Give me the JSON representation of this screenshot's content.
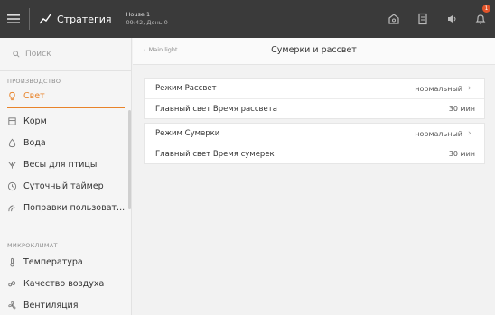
{
  "header": {
    "strategy_label": "Стратегия",
    "house_name": "House 1",
    "house_time": "09:42, День 0",
    "notification_count": "1"
  },
  "sidebar": {
    "search_placeholder": "Поиск",
    "section_production": "ПРОИЗВОДСТВО",
    "section_microclimate": "МИКРОКЛИМАТ",
    "items": [
      {
        "label": "Свет",
        "icon": "lightbulb-icon",
        "active": true
      },
      {
        "label": "Корм",
        "icon": "feed-icon"
      },
      {
        "label": "Вода",
        "icon": "water-drop-icon"
      },
      {
        "label": "Весы для птицы",
        "icon": "bird-scale-icon"
      },
      {
        "label": "Суточный таймер",
        "icon": "clock-icon"
      },
      {
        "label": "Поправки пользоват...",
        "icon": "user-adjust-icon"
      },
      {
        "label": "Температура",
        "icon": "thermometer-icon"
      },
      {
        "label": "Качество воздуха",
        "icon": "air-quality-icon"
      },
      {
        "label": "Вентиляция",
        "icon": "ventilation-icon"
      }
    ]
  },
  "main": {
    "back_label": "Main light",
    "title": "Сумерки и рассвет",
    "rows": [
      {
        "label": "Режим Рассвет",
        "value": "нормальный"
      },
      {
        "label": "Главный свет Время рассвета",
        "value": "30 мин"
      },
      {
        "label": "Режим Сумерки",
        "value": "нормальный"
      },
      {
        "label": "Главный свет Время сумерек",
        "value": "30 мин"
      }
    ]
  },
  "colors": {
    "accent": "#e8832a",
    "topbar": "#3a3a3a",
    "badge": "#e2542a"
  }
}
